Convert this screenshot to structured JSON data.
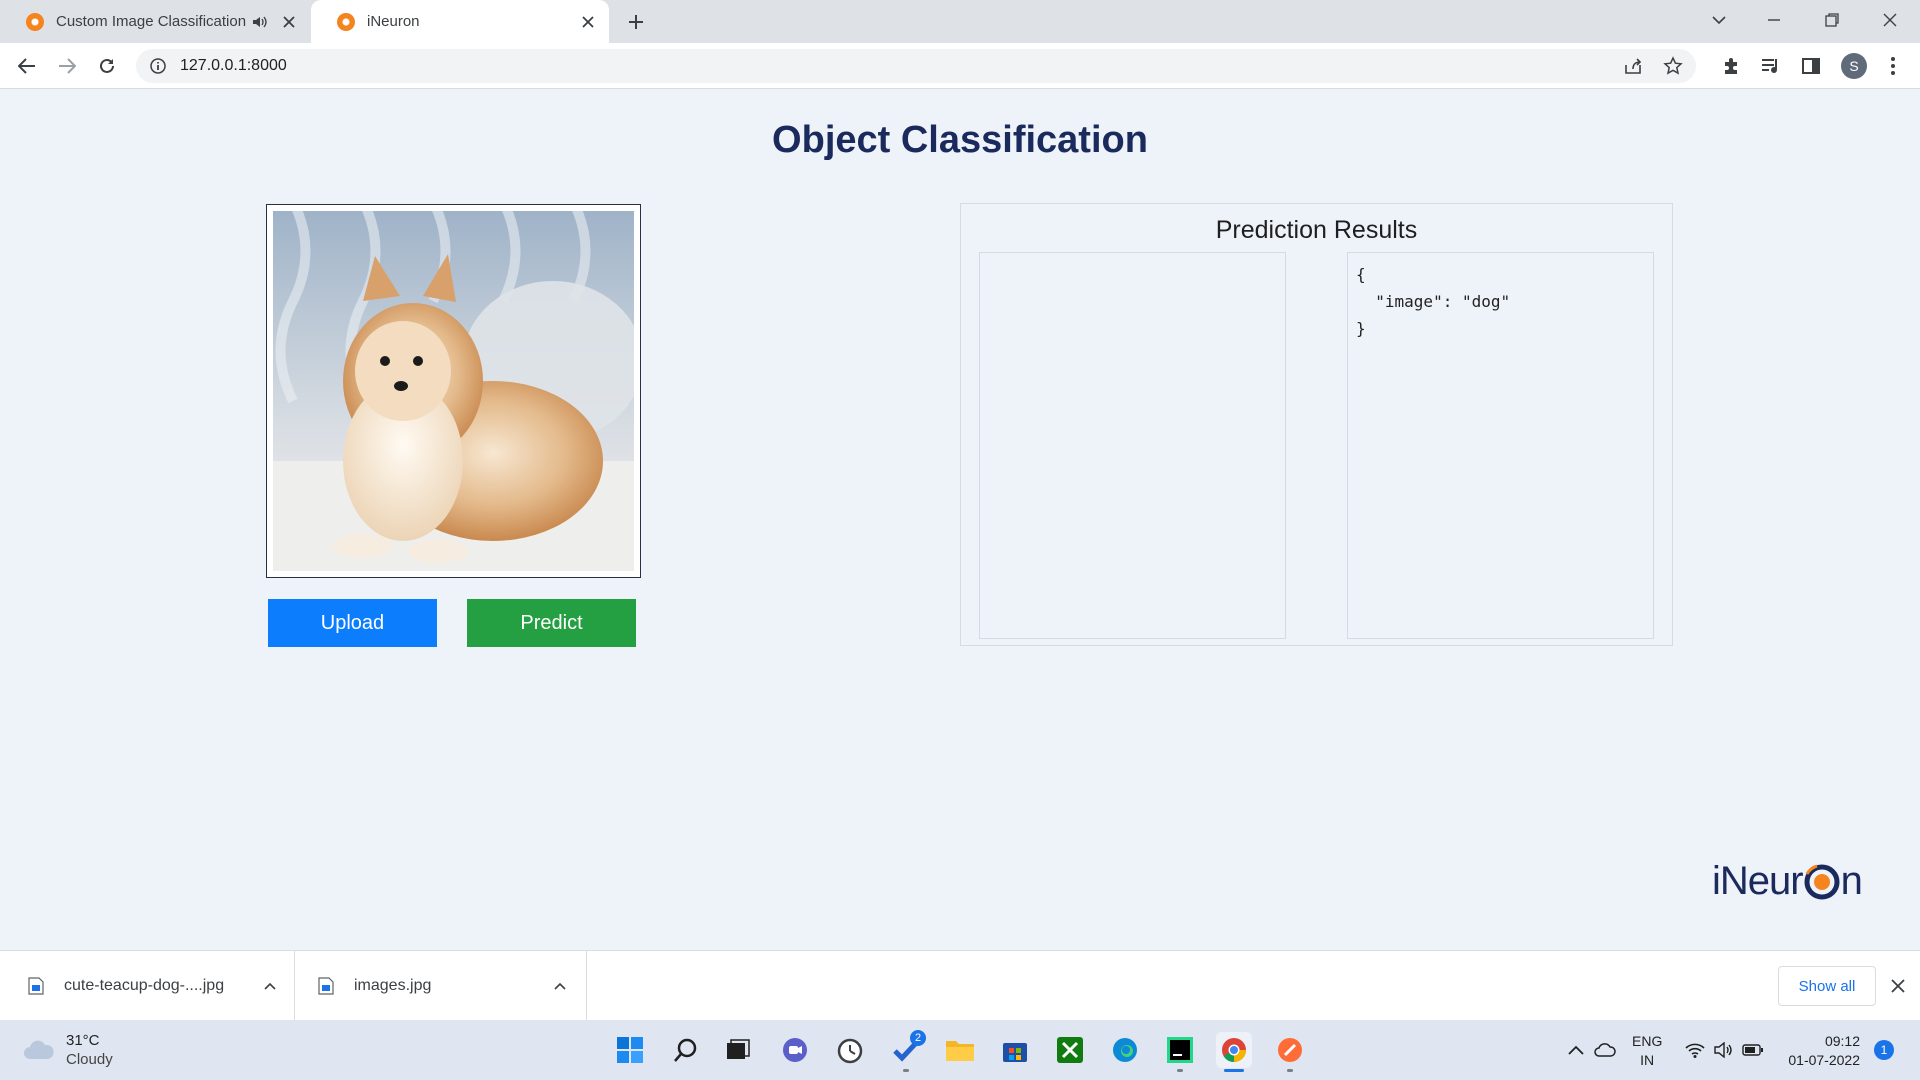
{
  "browser": {
    "tabs": [
      {
        "title": "Custom Image Classification",
        "active": false,
        "audio": true
      },
      {
        "title": "iNeuron",
        "active": true,
        "audio": false
      }
    ],
    "url": "127.0.0.1:8000",
    "profile_initial": "S"
  },
  "page": {
    "title": "Object Classification",
    "upload_label": "Upload",
    "predict_label": "Predict",
    "results_title": "Prediction Results",
    "result_json": "{\n  \"image\": \"dog\"\n}",
    "logo_text_left": "iNeur",
    "logo_text_right": "n"
  },
  "downloads": {
    "items": [
      {
        "name": "cute-teacup-dog-....jpg"
      },
      {
        "name": "images.jpg"
      }
    ],
    "show_all_label": "Show all"
  },
  "taskbar": {
    "weather_temp": "31°C",
    "weather_condition": "Cloudy",
    "todo_badge": "2",
    "lang_top": "ENG",
    "lang_bottom": "IN",
    "time": "09:12",
    "date": "01-07-2022",
    "notification_count": "1"
  },
  "colors": {
    "upload_button": "#0b7dfd",
    "predict_button": "#24a043",
    "title": "#1b2a5c",
    "page_background": "#eef2f9"
  }
}
